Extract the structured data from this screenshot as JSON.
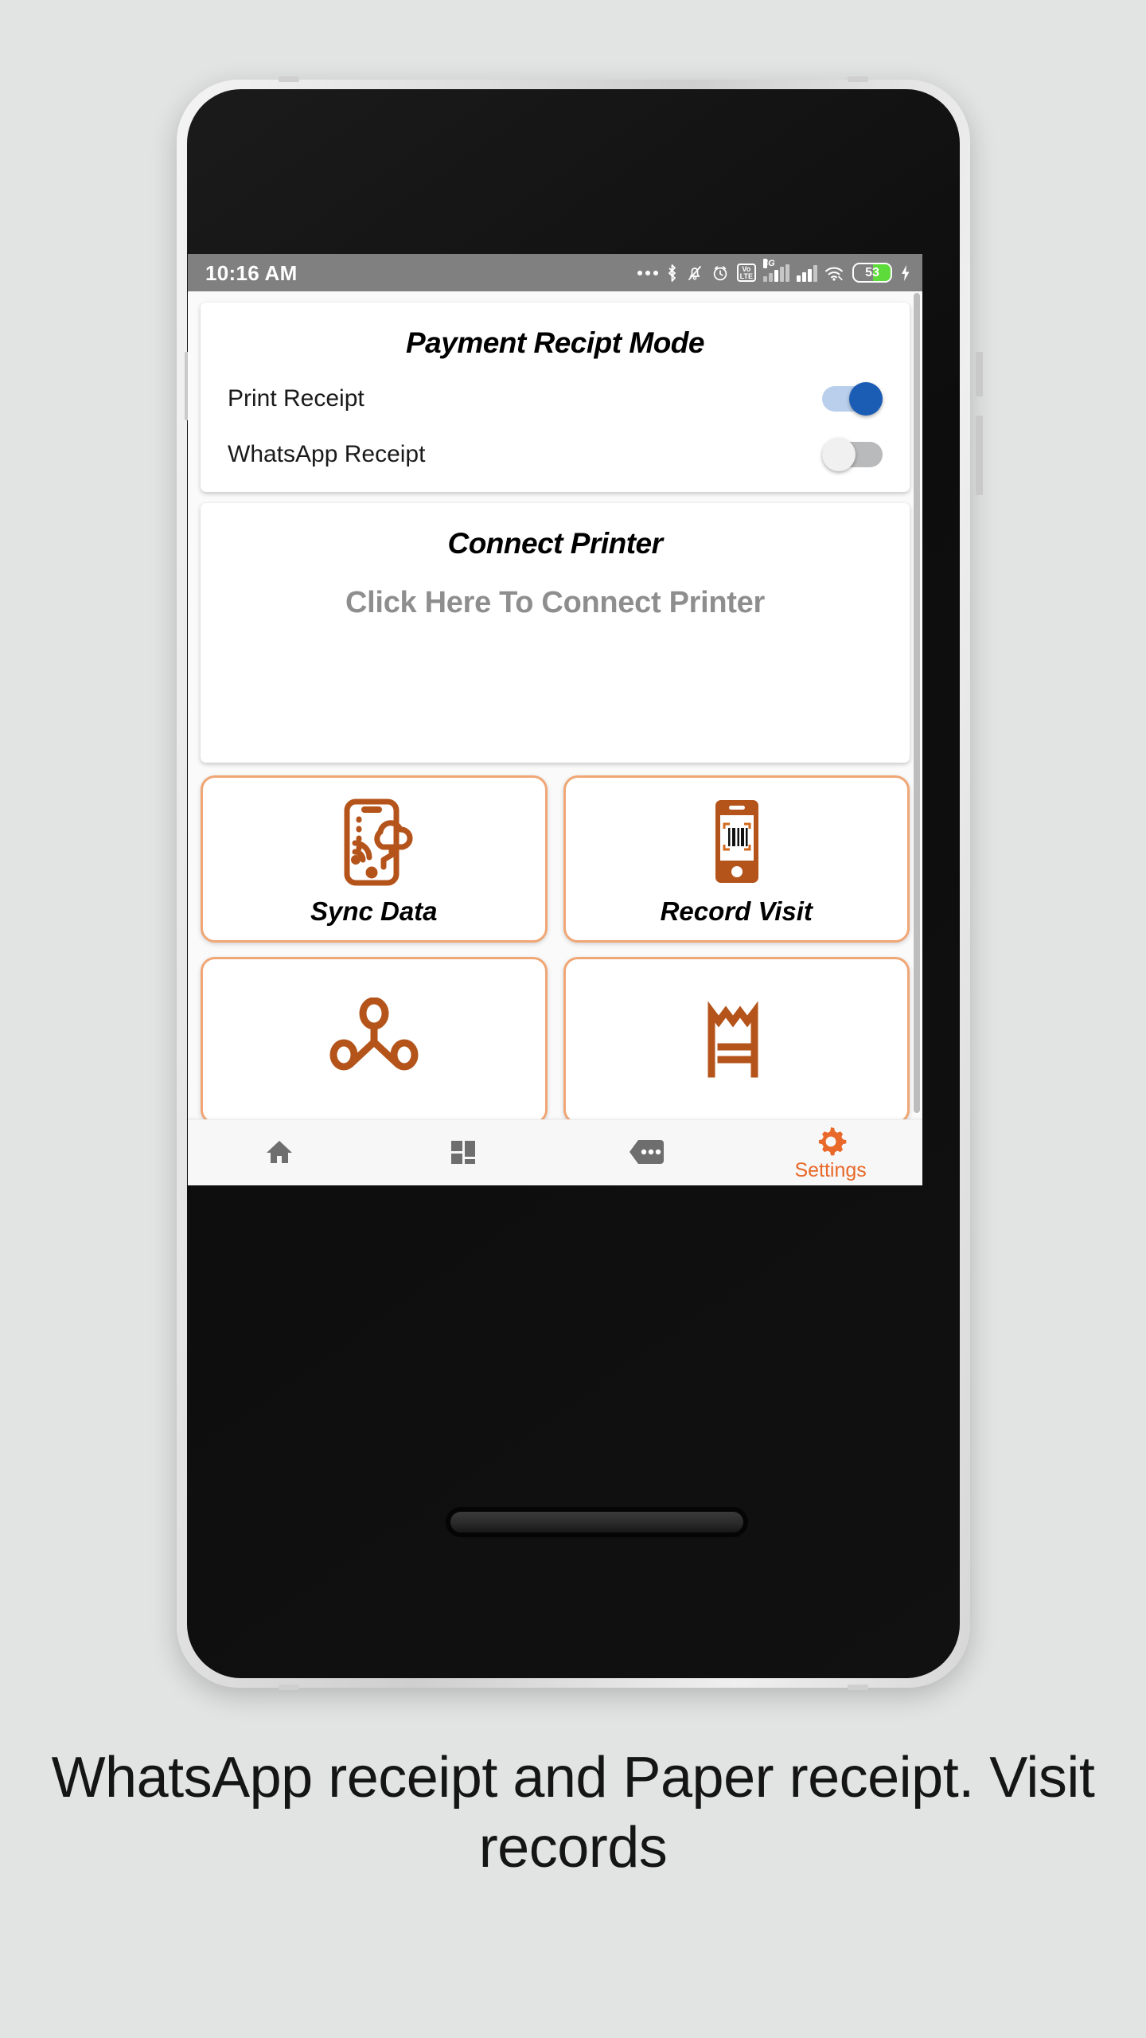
{
  "status_bar": {
    "time": "10:16 AM",
    "battery_percent": "53",
    "volte_top": "Vo",
    "volte_bottom": "LTE",
    "network_label": "4G",
    "icons": [
      "more-dots-icon",
      "bluetooth-icon",
      "mute-bell-icon",
      "alarm-icon",
      "volte-icon",
      "signal-4g-icon",
      "signal-icon",
      "wifi-icon",
      "battery-icon",
      "charging-bolt-icon"
    ]
  },
  "receipt_card": {
    "title": "Payment Recipt Mode",
    "rows": [
      {
        "label": "Print Receipt",
        "state": "on"
      },
      {
        "label": "WhatsApp Receipt",
        "state": "off"
      }
    ]
  },
  "printer_card": {
    "title": "Connect Printer",
    "subtitle": "Click Here To Connect Printer"
  },
  "tiles": [
    {
      "label": "Sync Data",
      "icon": "phone-cloud-sync-icon"
    },
    {
      "label": "Record Visit",
      "icon": "phone-barcode-scan-icon"
    },
    {
      "label": "",
      "icon": "network-nodes-icon"
    },
    {
      "label": "",
      "icon": "receipt-bill-icon"
    }
  ],
  "bottom_nav": {
    "items": [
      {
        "label": "",
        "icon": "home-icon",
        "active": false
      },
      {
        "label": "",
        "icon": "dashboard-grid-icon",
        "active": false
      },
      {
        "label": "",
        "icon": "chat-dots-icon",
        "active": false
      },
      {
        "label": "Settings",
        "icon": "gear-icon",
        "active": true
      }
    ]
  },
  "system_nav": {
    "recents": "recents-square-icon",
    "home": "home-circle-icon",
    "back": "back-triangle-icon"
  },
  "caption": "WhatsApp receipt and Paper receipt. Visit records",
  "colors": {
    "accent": "#e8692a",
    "tile_border": "#f0a675",
    "icon_brown": "#b4541b",
    "toggle_on_thumb": "#1b5cb5",
    "toggle_on_track": "#b9cfeb",
    "page_bg": "#e2e3e3",
    "status_bar_bg": "#808080",
    "battery_green": "#5ddb3a"
  }
}
